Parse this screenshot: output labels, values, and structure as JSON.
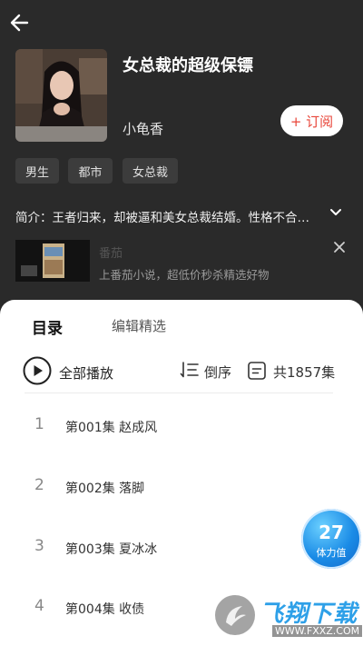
{
  "header": {
    "back_icon": "arrow-left-icon"
  },
  "book": {
    "title": "女总裁的超级保镖",
    "author": "小龟香",
    "subscribe_label": "+ 订阅",
    "tags": [
      "男生",
      "都市",
      "女总裁"
    ],
    "intro": "简介：王者归来，却被逼和美女总裁结婚。性格不合…"
  },
  "ad": {
    "name": "番茄",
    "description": "上番茄小说，超低价秒杀精选好物"
  },
  "sheet": {
    "tabs": [
      "目录",
      "编辑精选"
    ],
    "play_all": "全部播放",
    "order": "倒序",
    "count": "共1857集",
    "episodes": [
      {
        "num": "1",
        "title": "第001集  赵成风"
      },
      {
        "num": "2",
        "title": "第002集  落脚"
      },
      {
        "num": "3",
        "title": "第003集  夏冰冰"
      },
      {
        "num": "4",
        "title": "第004集  收债"
      }
    ]
  },
  "stamina": {
    "value": "27",
    "label": "体力值"
  },
  "watermark": {
    "brand": "飞翔下载",
    "url": "WWW.FXXZ.COM"
  },
  "colors": {
    "accent": "#e8463a",
    "background": "#2a2a2a",
    "stamina": "#1a8be6"
  }
}
